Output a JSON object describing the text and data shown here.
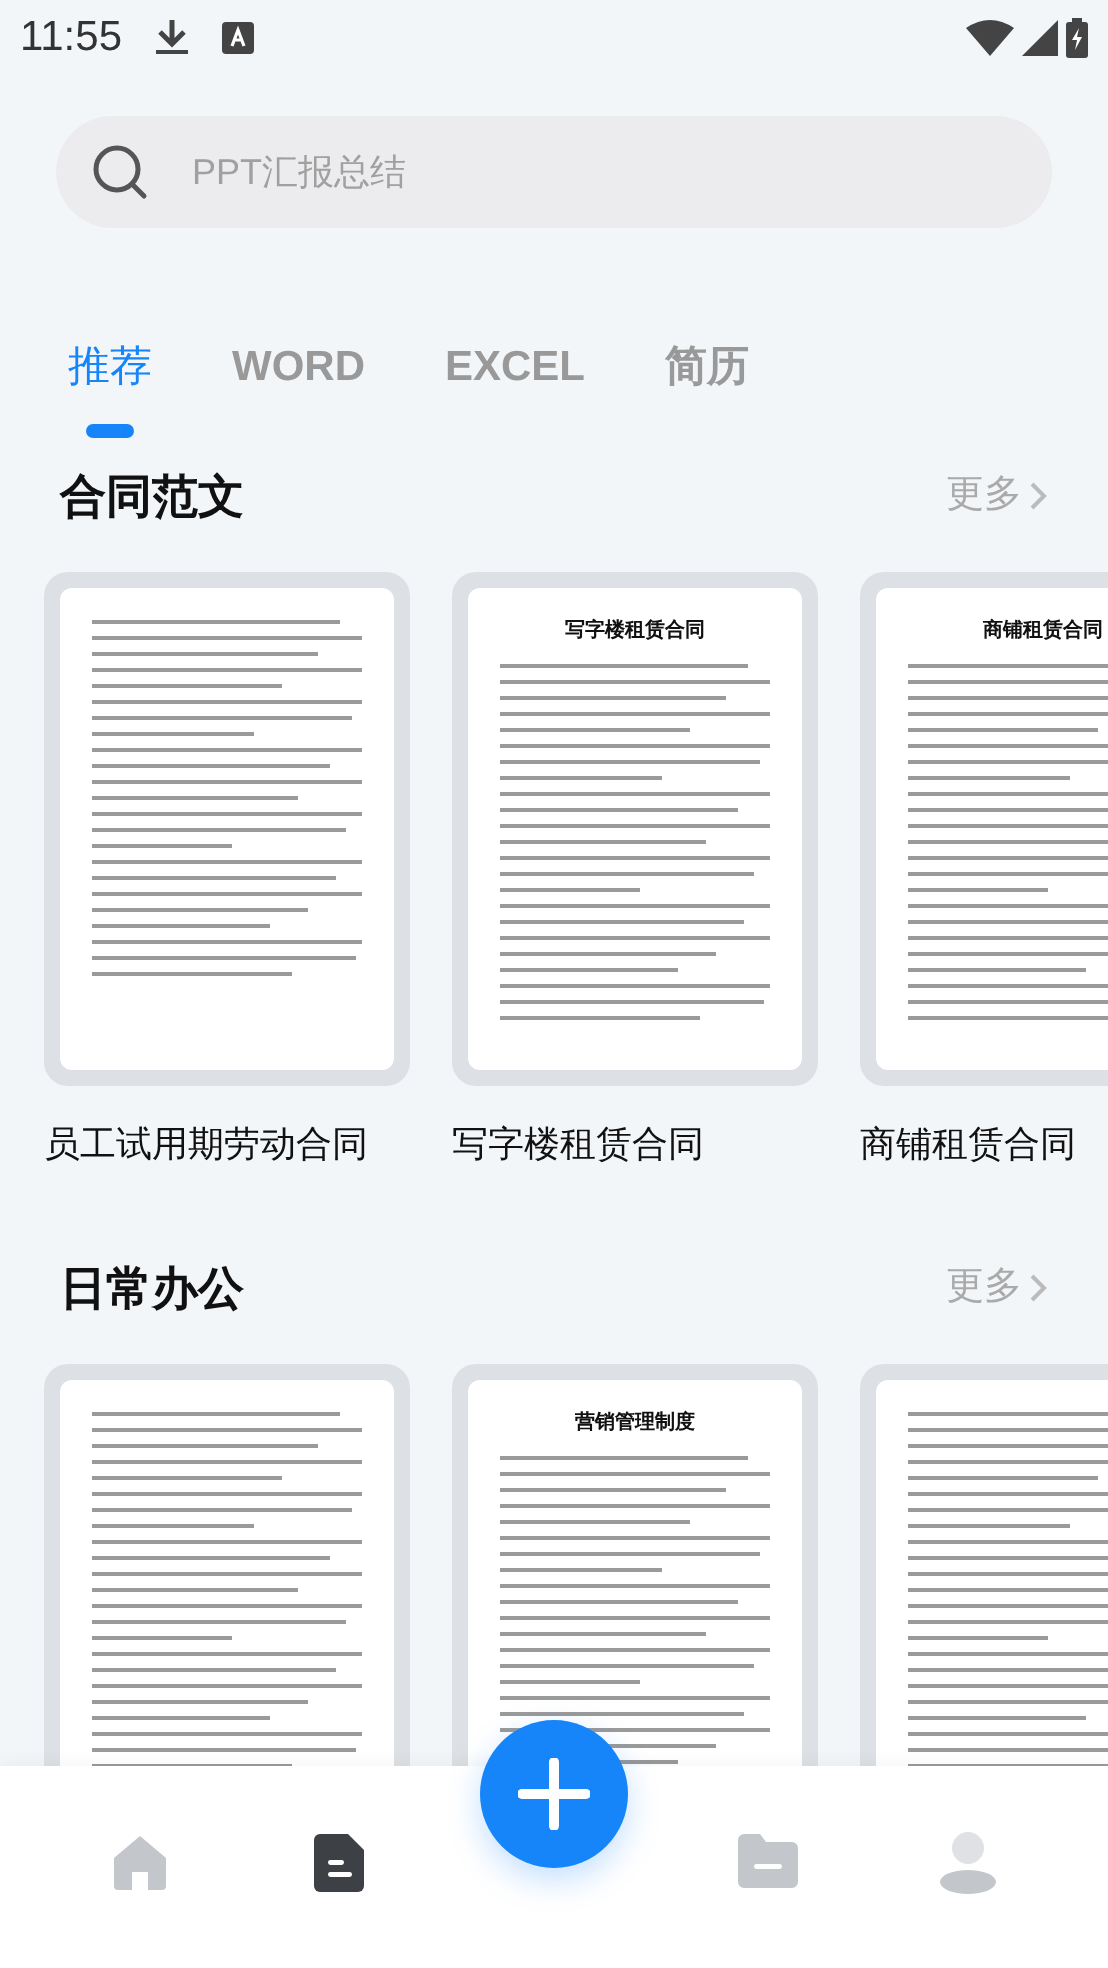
{
  "status_bar": {
    "time": "11:55"
  },
  "search": {
    "placeholder": "PPT汇报总结"
  },
  "tabs": [
    {
      "label": "推荐",
      "selected": true
    },
    {
      "label": "WORD",
      "selected": false
    },
    {
      "label": "EXCEL",
      "selected": false
    },
    {
      "label": "简历",
      "selected": false
    }
  ],
  "sections": [
    {
      "title": "合同范文",
      "more": "更多",
      "templates": [
        {
          "kind": "document",
          "name": "员工试用期劳动合同"
        },
        {
          "kind": "document",
          "name": "写字楼租赁合同",
          "doc_title": "写字楼租赁合同"
        },
        {
          "kind": "document",
          "name": "商铺租赁合同",
          "doc_title": "商铺租赁合同"
        }
      ]
    },
    {
      "title": "日常办公",
      "more": "更多",
      "templates": [
        {
          "kind": "document"
        },
        {
          "kind": "document",
          "doc_title": "营销管理制度"
        },
        {
          "kind": "document"
        }
      ]
    }
  ],
  "bottom_nav": [
    {
      "kind": "home",
      "selected": false
    },
    {
      "kind": "document",
      "selected": true
    },
    {
      "kind": "add"
    },
    {
      "kind": "folder",
      "selected": false
    },
    {
      "kind": "profile",
      "selected": false
    }
  ]
}
